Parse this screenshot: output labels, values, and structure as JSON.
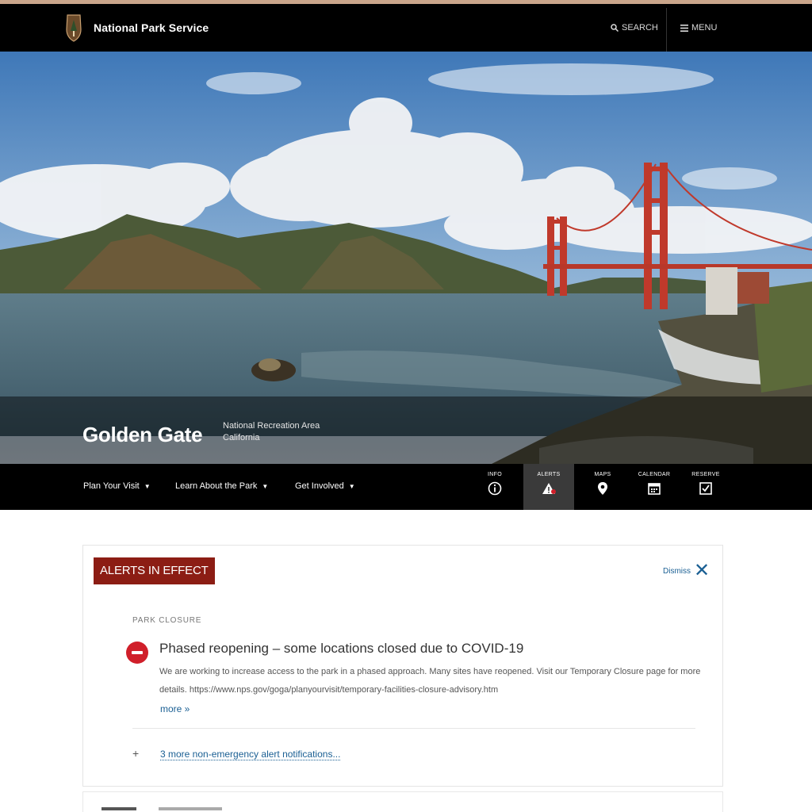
{
  "header": {
    "brand": "National Park Service",
    "search_label": "SEARCH",
    "menu_label": "MENU"
  },
  "hero": {
    "park_name": "Golden Gate",
    "designation": "National Recreation Area",
    "state": "California"
  },
  "park_nav": {
    "menus": [
      {
        "label": "Plan Your Visit"
      },
      {
        "label": "Learn About the Park"
      },
      {
        "label": "Get Involved"
      }
    ],
    "quick_links": [
      {
        "label": "Info",
        "icon": "info-icon"
      },
      {
        "label": "Alerts",
        "icon": "alert-icon"
      },
      {
        "label": "Maps",
        "icon": "map-icon"
      },
      {
        "label": "Calendar",
        "icon": "calendar-icon"
      },
      {
        "label": "Reserve",
        "icon": "reserve-icon"
      }
    ]
  },
  "alerts": {
    "title": "ALERTS IN EFFECT",
    "dismiss_label": "Dismiss",
    "category": "PARK CLOSURE",
    "headline": "Phased reopening – some locations closed due to COVID-19",
    "body": "We are working to increase access to the park in a phased approach. Many sites have reopened. Visit our Temporary Closure page for more details. https://www.nps.gov/goga/planyourvisit/temporary-facilities-closure-advisory.htm",
    "more_label": "more »",
    "more_notifications": "3 more non-emergency alert notifications..."
  },
  "colors": {
    "alert_red": "#8c1d14",
    "link_blue": "#1a5f93",
    "icon_red": "#d01f2a"
  }
}
